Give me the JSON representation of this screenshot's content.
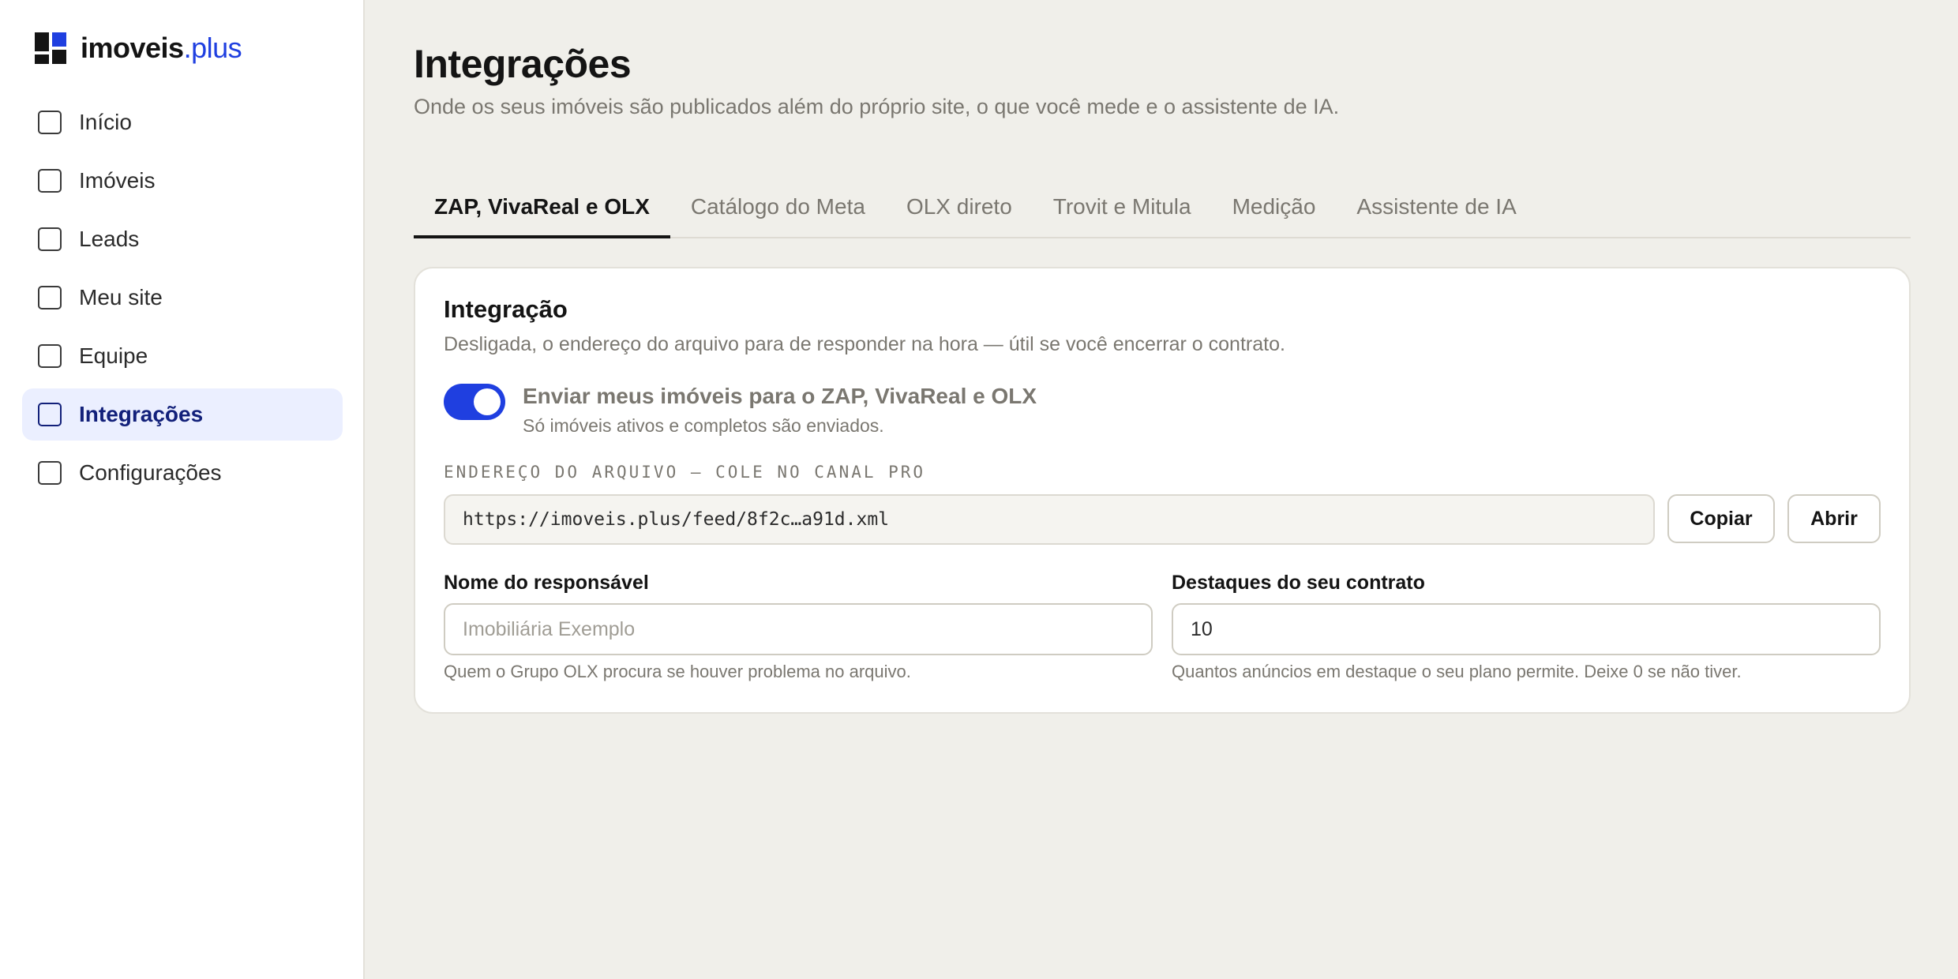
{
  "brand": {
    "name": "imoveis",
    "tld": ".plus"
  },
  "sidebar": {
    "items": [
      {
        "label": "Início",
        "active": false
      },
      {
        "label": "Imóveis",
        "active": false
      },
      {
        "label": "Leads",
        "active": false
      },
      {
        "label": "Meu site",
        "active": false
      },
      {
        "label": "Equipe",
        "active": false
      },
      {
        "label": "Integrações",
        "active": true
      },
      {
        "label": "Configurações",
        "active": false
      }
    ]
  },
  "page": {
    "title": "Integrações",
    "subtitle": "Onde os seus imóveis são publicados além do próprio site, o que você mede e o assistente de IA."
  },
  "tabs": [
    {
      "label": "ZAP, VivaReal e OLX",
      "active": true
    },
    {
      "label": "Catálogo do Meta",
      "active": false
    },
    {
      "label": "OLX direto",
      "active": false
    },
    {
      "label": "Trovit e Mitula",
      "active": false
    },
    {
      "label": "Medição",
      "active": false
    },
    {
      "label": "Assistente de IA",
      "active": false
    }
  ],
  "card": {
    "title": "Integração",
    "description": "Desligada, o endereço do arquivo para de responder na hora — útil se você encerrar o contrato.",
    "toggle": {
      "on": true,
      "label": "Enviar meus imóveis para o ZAP, VivaReal e OLX",
      "help": "Só imóveis ativos e completos são enviados."
    },
    "feed": {
      "label": "ENDEREÇO DO ARQUIVO — COLE NO CANAL PRO",
      "url": "https://imoveis.plus/feed/8f2c…a91d.xml",
      "copy_label": "Copiar",
      "open_label": "Abrir"
    },
    "responsible": {
      "label": "Nome do responsável",
      "value": "",
      "placeholder": "Imobiliária Exemplo",
      "help": "Quem o Grupo OLX procura se houver problema no arquivo."
    },
    "highlights": {
      "label": "Destaques do seu contrato",
      "value": "10",
      "placeholder": "",
      "help": "Quantos anúncios em destaque o seu plano permite. Deixe 0 se não tiver."
    }
  },
  "colors": {
    "accent": "#1f3fe0",
    "nav_active_bg": "#ebefff",
    "nav_active_text": "#12207a",
    "page_bg": "#f0efea",
    "muted_text": "#7a7770"
  },
  "icons": {
    "logo": "brand-logo-icon",
    "nav": "checkbox-square-icon"
  }
}
